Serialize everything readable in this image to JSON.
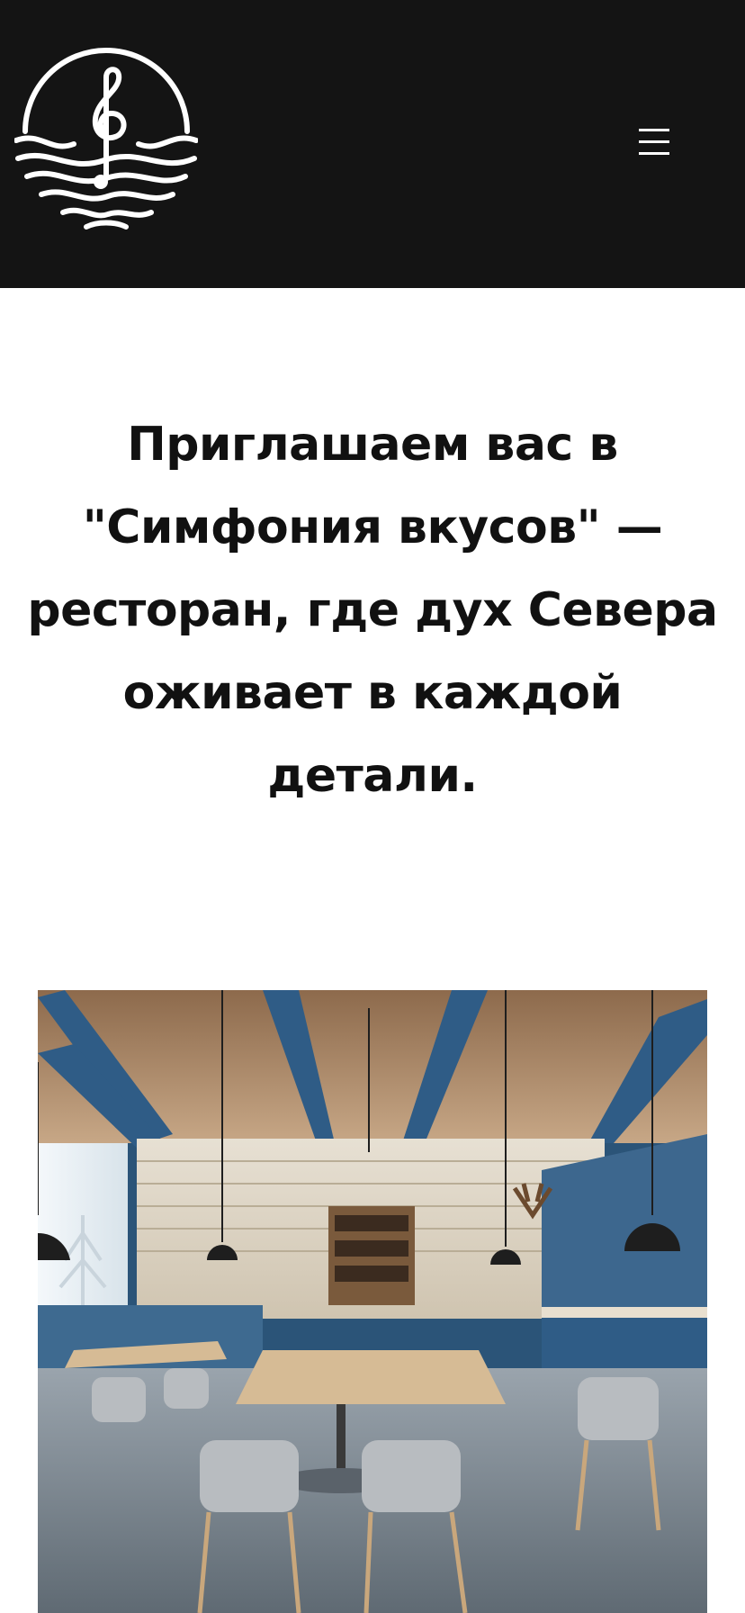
{
  "header": {
    "logo_icon": "treble-clef-waves-logo-icon",
    "menu_icon": "hamburger-menu-icon",
    "background": "#141414"
  },
  "hero": {
    "text": "Приглашаем вас в \"Симфония вкусов\" — ресторан, где дух Севера оживает в каждой детали."
  },
  "photo": {
    "subject": "scandinavian-restaurant-interior",
    "accent": "#2f5c86"
  }
}
